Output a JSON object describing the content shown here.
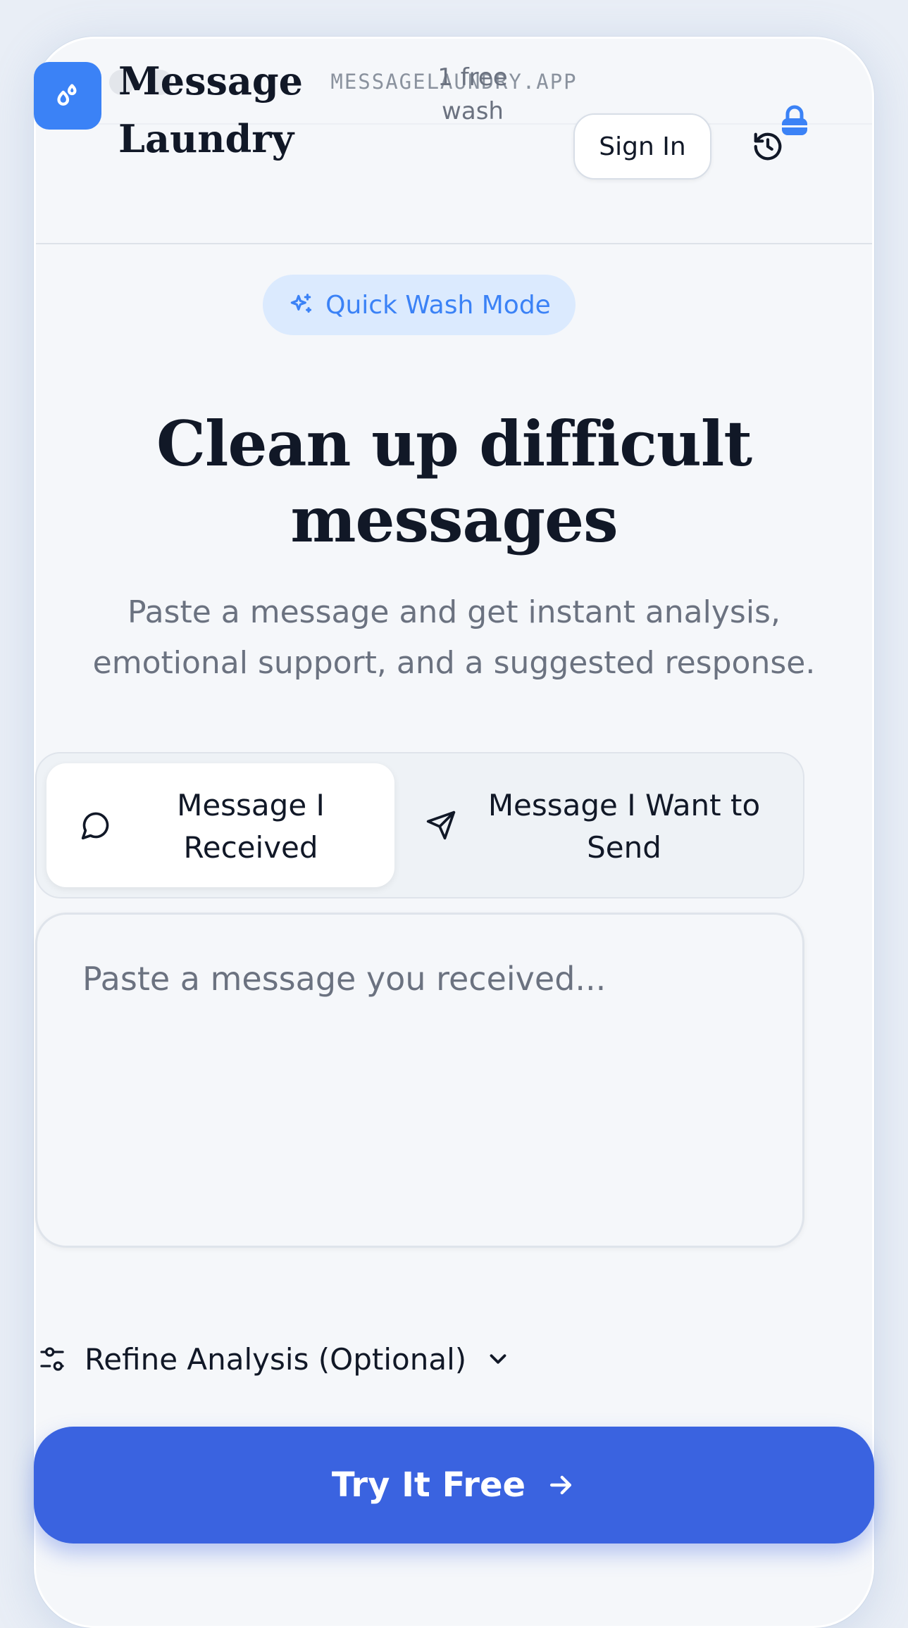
{
  "browser": {
    "url": "MESSAGELAUNDRY.APP"
  },
  "header": {
    "brand": "Message Laundry",
    "free_line1": "1 free",
    "free_line2": "wash",
    "signin_label": "Sign In"
  },
  "hero": {
    "badge": "Quick Wash Mode",
    "headline_line1": "Clean up difficult",
    "headline_line2": "messages",
    "subtext_line1": "Paste a message and get instant analysis,",
    "subtext_line2": "emotional support, and a suggested response."
  },
  "mode_toggle": {
    "received_line1": "Message I",
    "received_line2": "Received",
    "send_line1": "Message I Want to",
    "send_line2": "Send",
    "selected": "received"
  },
  "input": {
    "placeholder": "Paste a message you received..."
  },
  "refine": {
    "label": "Refine Analysis (Optional)"
  },
  "cta": {
    "label": "Try It Free"
  },
  "colors": {
    "accent": "#3b82f6",
    "cta": "#3a63e0",
    "badge_bg": "#dbeafe",
    "text": "#111827",
    "muted": "#6b7280"
  }
}
